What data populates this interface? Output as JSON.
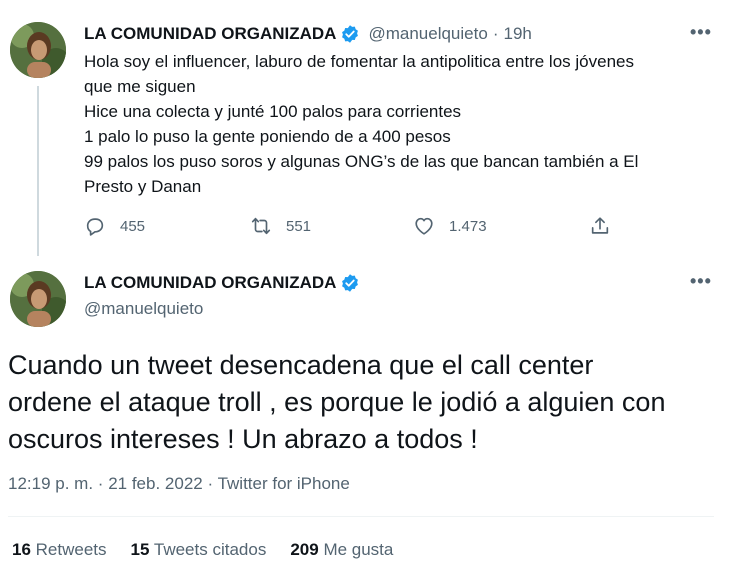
{
  "reply_tweet": {
    "author_name": "LA COMUNIDAD ORGANIZADA",
    "handle": "@manuelquieto",
    "separator": "·",
    "time_ago": "19h",
    "lines": [
      "Hola soy el influencer, laburo de fomentar la antipolitica entre los jóvenes",
      "que me siguen",
      "Hice una colecta y junté 100 palos para corrientes",
      "1 palo lo puso la gente poniendo de a 400 pesos",
      "99 palos los puso soros y algunas ONG’s de las que bancan también a El",
      "Presto y Danan"
    ],
    "replies": "455",
    "retweets": "551",
    "likes": "1.473"
  },
  "main_tweet": {
    "author_name": "LA COMUNIDAD ORGANIZADA",
    "handle": "@manuelquieto",
    "lines": [
      "Cuando un tweet desencadena que el call center",
      "ordene el ataque troll , es porque le jodió a alguien con",
      "oscuros intereses ! Un abrazo a todos !"
    ],
    "time": "12:19 p. m.",
    "date": "21 feb. 2022",
    "source": "Twitter for iPhone",
    "meta_separator": "·"
  },
  "stats": {
    "retweets_count": "16",
    "retweets_label": "Retweets",
    "quotes_count": "15",
    "quotes_label": "Tweets citados",
    "likes_count": "209",
    "likes_label": "Me gusta"
  },
  "icons": {
    "more": "more-icon",
    "verified": "verified-badge-icon",
    "reply": "reply-icon",
    "retweet": "retweet-icon",
    "like": "heart-icon",
    "share": "share-icon"
  },
  "colors": {
    "verified": "#1d9bf0",
    "muted": "#536471",
    "text": "#0f1419"
  }
}
